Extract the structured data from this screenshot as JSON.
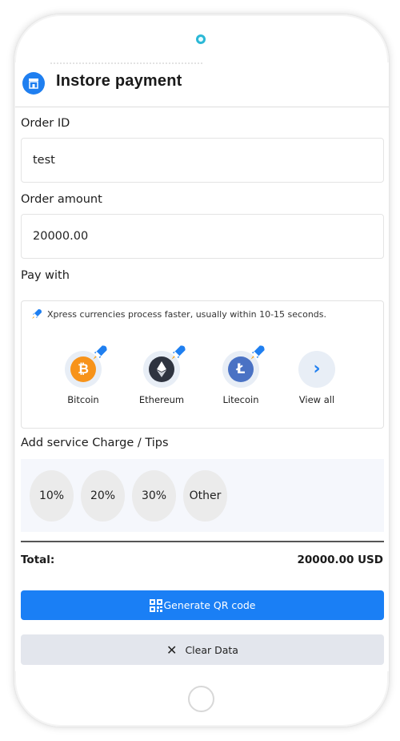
{
  "header": {
    "title": "Instore payment",
    "icon": "store-icon"
  },
  "order_id": {
    "label": "Order ID",
    "value": "test"
  },
  "order_amount": {
    "label": "Order amount",
    "value": "20000.00"
  },
  "pay_with": {
    "label": "Pay with",
    "notice": "Xpress currencies process faster, usually within 10-15 seconds.",
    "coins": [
      {
        "name": "Bitcoin",
        "icon": "bitcoin-icon",
        "color": "#f7931a",
        "xpress": true
      },
      {
        "name": "Ethereum",
        "icon": "ethereum-icon",
        "color": "#2f3440",
        "xpress": true
      },
      {
        "name": "Litecoin",
        "icon": "litecoin-icon",
        "color": "#4a72c4",
        "xpress": true
      },
      {
        "name": "View all",
        "icon": "chevron-right-icon"
      }
    ]
  },
  "tips": {
    "label": "Add service Charge / Tips",
    "options": [
      "10%",
      "20%",
      "30%",
      "Other"
    ]
  },
  "total": {
    "label": "Total:",
    "value": "20000.00 USD"
  },
  "actions": {
    "generate_qr": "Generate QR code",
    "clear_data": "Clear Data"
  },
  "colors": {
    "accent": "#1a7ff5",
    "secondary_button": "#e3e6ed",
    "tips_background": "#f5f7fc"
  }
}
